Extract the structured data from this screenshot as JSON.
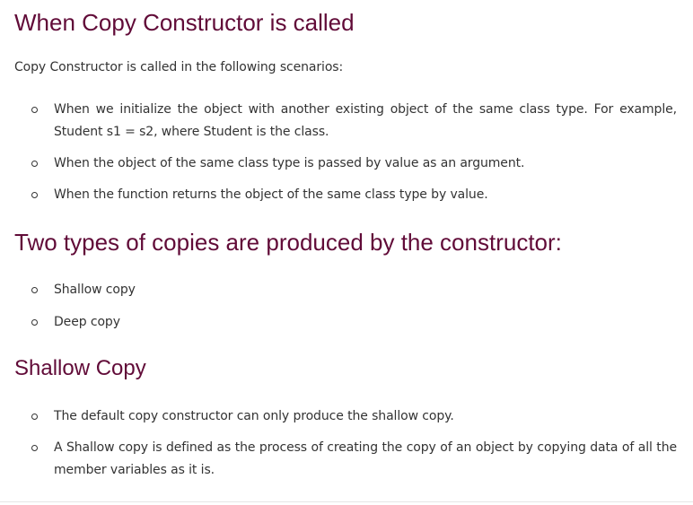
{
  "section1": {
    "heading": "When Copy Constructor is called",
    "intro": "Copy Constructor is called in the following scenarios:",
    "items": [
      "When we initialize the object with another existing object of the same class type. For example, Student s1 = s2, where Student is the class.",
      "When the object of the same class type is passed by value as an argument.",
      "When the function returns the object of the same class type by value."
    ]
  },
  "section2": {
    "heading": "Two types of copies are produced by the constructor:",
    "items": [
      "Shallow copy",
      "Deep copy"
    ]
  },
  "section3": {
    "heading": "Shallow Copy",
    "items": [
      "The default copy constructor can only produce the shallow copy.",
      "A Shallow copy is defined as the process of creating the copy of an object by copying data of all the member variables as it is."
    ]
  },
  "colors": {
    "heading": "#610B38",
    "text": "#333333"
  }
}
